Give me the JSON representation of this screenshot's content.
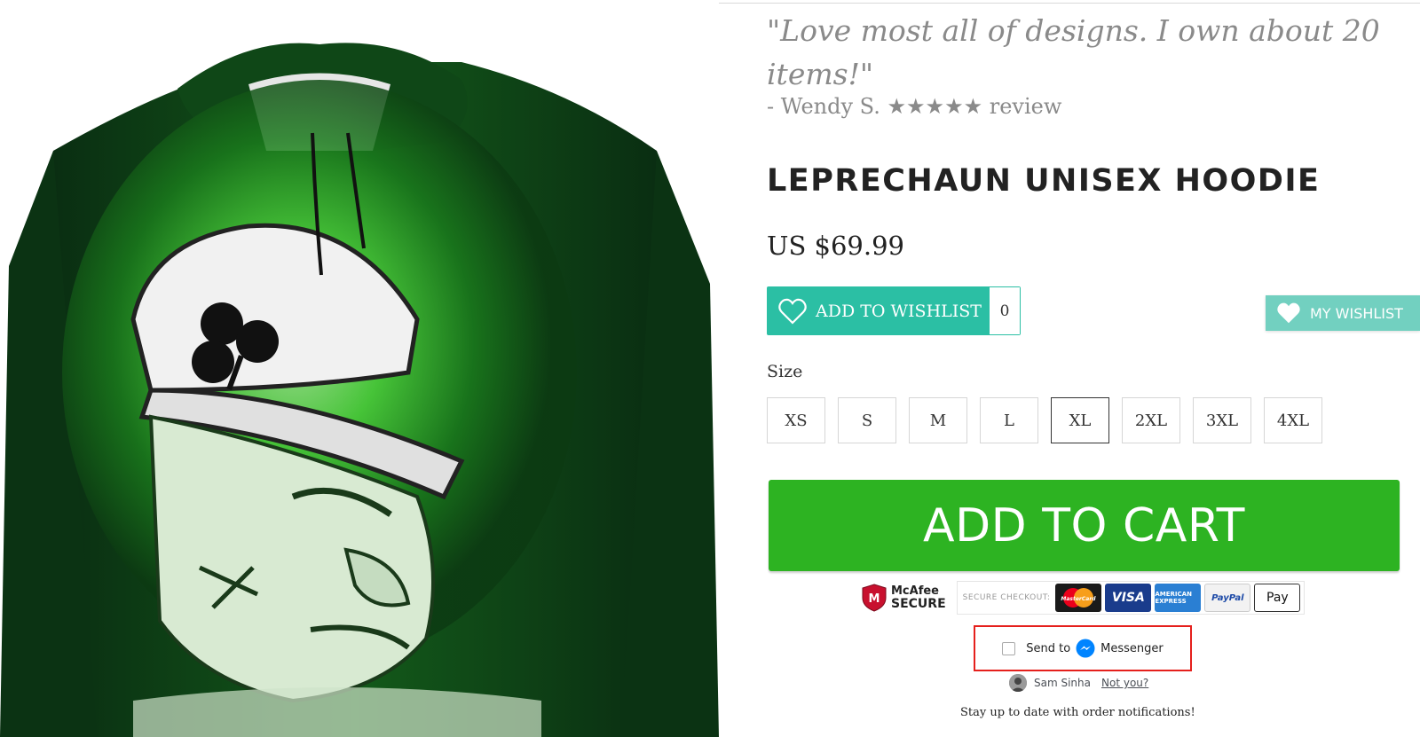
{
  "testimonial": {
    "quote": "\"Love most all of designs. I own about 20 items!\"",
    "author": "- Wendy S.",
    "stars": "★★★★★",
    "suffix": "review"
  },
  "product": {
    "title": "LEPRECHAUN UNISEX HOODIE",
    "price": "US $69.99",
    "image_icon": "hoodie-image"
  },
  "wishlist": {
    "button_label": "ADD TO WISHLIST",
    "count": "0",
    "floating_label": "MY WISHLIST",
    "icon": "heart-icon",
    "color": "#2bbfa4",
    "floating_color": "#72d0c0"
  },
  "size": {
    "label": "Size",
    "options": [
      "XS",
      "S",
      "M",
      "L",
      "XL",
      "2XL",
      "3XL",
      "4XL"
    ],
    "selected": "XL"
  },
  "cart": {
    "button_label": "ADD TO CART",
    "color": "#2db322"
  },
  "trust": {
    "mcafee_line1": "McAfee",
    "mcafee_line2": "SECURE",
    "secure_checkout_label": "SECURE CHECKOUT:",
    "cards": {
      "mastercard": "MasterCard",
      "visa": "VISA",
      "amex": "AMERICAN EXPRESS",
      "paypal": "PayPal",
      "applepay": "Pay"
    }
  },
  "messenger": {
    "send_to": "Send to",
    "name": "Messenger",
    "icon": "messenger-icon",
    "highlight_color": "#e5201c"
  },
  "user": {
    "name": "Sam Sinha",
    "not_you": "Not you?"
  },
  "notify_text": "Stay up to date with order notifications!"
}
